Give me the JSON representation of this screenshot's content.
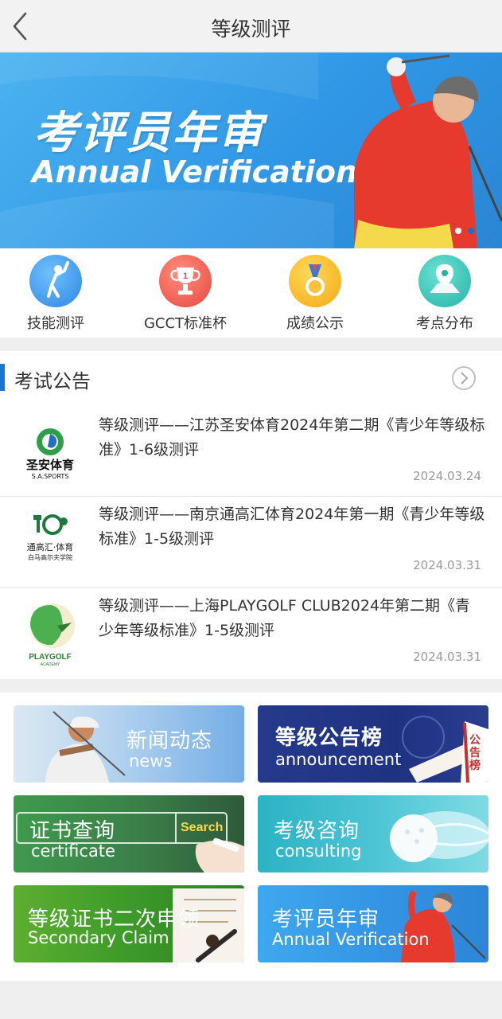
{
  "header": {
    "title": "等级测评"
  },
  "banner": {
    "title": "考评员年审",
    "subtitle": "Annual Verification",
    "active_dot": 0
  },
  "categories": [
    {
      "label": "技能测评",
      "icon": "golfer-icon",
      "color": "#4aa3f0"
    },
    {
      "label": "GCCT标准杯",
      "icon": "trophy-icon",
      "color": "#f0605a"
    },
    {
      "label": "成绩公示",
      "icon": "medal-icon",
      "color": "#f7b81c"
    },
    {
      "label": "考点分布",
      "icon": "map-pin-icon",
      "color": "#36c4b8"
    }
  ],
  "notices": {
    "heading": "考试公告",
    "items": [
      {
        "logo_text": "圣安体育",
        "logo_sub": "S.A.SPORTS",
        "text": "等级测评——江苏圣安体育2024年第二期《青少年等级标准》1-6级测评",
        "date": "2024.03.24"
      },
      {
        "logo_text": "通高汇·体育",
        "logo_sub": "白马高尔夫学院",
        "text": "等级测评——南京通高汇体育2024年第一期《青少年等级标准》1-5级测评",
        "date": "2024.03.31"
      },
      {
        "logo_text": "PLAYGOLF",
        "logo_sub": "ACADEMY",
        "text": "等级测评——上海PLAYGOLF CLUB2024年第二期《青少年等级标准》1-5级测评",
        "date": "2024.03.31"
      }
    ]
  },
  "tiles": [
    {
      "title": "新闻动态",
      "subtitle": "news"
    },
    {
      "title": "等级公告榜",
      "subtitle": "announcement",
      "badge": "公告榜"
    },
    {
      "title": "证书查询",
      "subtitle": "certificate",
      "badge": "Search"
    },
    {
      "title": "考级咨询",
      "subtitle": "consulting"
    },
    {
      "title": "等级证书二次申领",
      "subtitle": "Secondary Claim"
    },
    {
      "title": "考评员年审",
      "subtitle": "Annual Verification"
    }
  ]
}
